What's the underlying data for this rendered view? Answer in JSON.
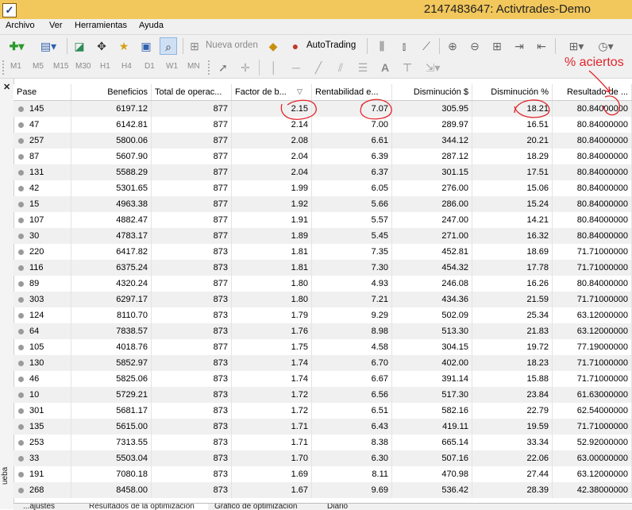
{
  "window": {
    "title": "2147483647: Activtrades-Demo"
  },
  "menu": [
    "Archivo",
    "Ver",
    "Herramientas",
    "Ayuda"
  ],
  "toolbar": {
    "new_order_label": "Nueva orden",
    "autotrading_label": "AutoTrading"
  },
  "timeframes": [
    "M1",
    "M5",
    "M15",
    "M30",
    "H1",
    "H4",
    "D1",
    "W1",
    "MN"
  ],
  "tester": {
    "side_tab": "ueba",
    "columns": [
      "Pase",
      "Beneficios",
      "Total de operac...",
      "Factor de b...",
      "Rentabilidad e...",
      "Disminución $",
      "Disminución %",
      "Resultado de ..."
    ],
    "rows": [
      [
        "145",
        "6197.12",
        "877",
        "2.15",
        "7.07",
        "305.95",
        "18.21",
        "80.84000000"
      ],
      [
        "47",
        "6142.81",
        "877",
        "2.14",
        "7.00",
        "289.97",
        "16.51",
        "80.84000000"
      ],
      [
        "257",
        "5800.06",
        "877",
        "2.08",
        "6.61",
        "344.12",
        "20.21",
        "80.84000000"
      ],
      [
        "87",
        "5607.90",
        "877",
        "2.04",
        "6.39",
        "287.12",
        "18.29",
        "80.84000000"
      ],
      [
        "131",
        "5588.29",
        "877",
        "2.04",
        "6.37",
        "301.15",
        "17.51",
        "80.84000000"
      ],
      [
        "42",
        "5301.65",
        "877",
        "1.99",
        "6.05",
        "276.00",
        "15.06",
        "80.84000000"
      ],
      [
        "15",
        "4963.38",
        "877",
        "1.92",
        "5.66",
        "286.00",
        "15.24",
        "80.84000000"
      ],
      [
        "107",
        "4882.47",
        "877",
        "1.91",
        "5.57",
        "247.00",
        "14.21",
        "80.84000000"
      ],
      [
        "30",
        "4783.17",
        "877",
        "1.89",
        "5.45",
        "271.00",
        "16.32",
        "80.84000000"
      ],
      [
        "220",
        "6417.82",
        "873",
        "1.81",
        "7.35",
        "452.81",
        "18.69",
        "71.71000000"
      ],
      [
        "116",
        "6375.24",
        "873",
        "1.81",
        "7.30",
        "454.32",
        "17.78",
        "71.71000000"
      ],
      [
        "89",
        "4320.24",
        "877",
        "1.80",
        "4.93",
        "246.08",
        "16.26",
        "80.84000000"
      ],
      [
        "303",
        "6297.17",
        "873",
        "1.80",
        "7.21",
        "434.36",
        "21.59",
        "71.71000000"
      ],
      [
        "124",
        "8110.70",
        "873",
        "1.79",
        "9.29",
        "502.09",
        "25.34",
        "63.12000000"
      ],
      [
        "64",
        "7838.57",
        "873",
        "1.76",
        "8.98",
        "513.30",
        "21.83",
        "63.12000000"
      ],
      [
        "105",
        "4018.76",
        "877",
        "1.75",
        "4.58",
        "304.15",
        "19.72",
        "77.19000000"
      ],
      [
        "130",
        "5852.97",
        "873",
        "1.74",
        "6.70",
        "402.00",
        "18.23",
        "71.71000000"
      ],
      [
        "46",
        "5825.06",
        "873",
        "1.74",
        "6.67",
        "391.14",
        "15.88",
        "71.71000000"
      ],
      [
        "10",
        "5729.21",
        "873",
        "1.72",
        "6.56",
        "517.30",
        "23.84",
        "61.63000000"
      ],
      [
        "301",
        "5681.17",
        "873",
        "1.72",
        "6.51",
        "582.16",
        "22.79",
        "62.54000000"
      ],
      [
        "135",
        "5615.00",
        "873",
        "1.71",
        "6.43",
        "419.11",
        "19.59",
        "71.71000000"
      ],
      [
        "253",
        "7313.55",
        "873",
        "1.71",
        "8.38",
        "665.14",
        "33.34",
        "52.92000000"
      ],
      [
        "33",
        "5503.04",
        "873",
        "1.70",
        "6.30",
        "507.16",
        "22.06",
        "63.00000000"
      ],
      [
        "191",
        "7080.18",
        "873",
        "1.69",
        "8.11",
        "470.98",
        "27.44",
        "63.12000000"
      ],
      [
        "268",
        "8458.00",
        "873",
        "1.67",
        "9.69",
        "536.42",
        "28.39",
        "42.38000000"
      ]
    ],
    "bottom_tabs": [
      "...ajustes",
      "Resultados de la optimización",
      "Gráfico de optimización",
      "Diario"
    ]
  },
  "annotation": {
    "text": "% aciertos",
    "color": "#e0242a"
  }
}
